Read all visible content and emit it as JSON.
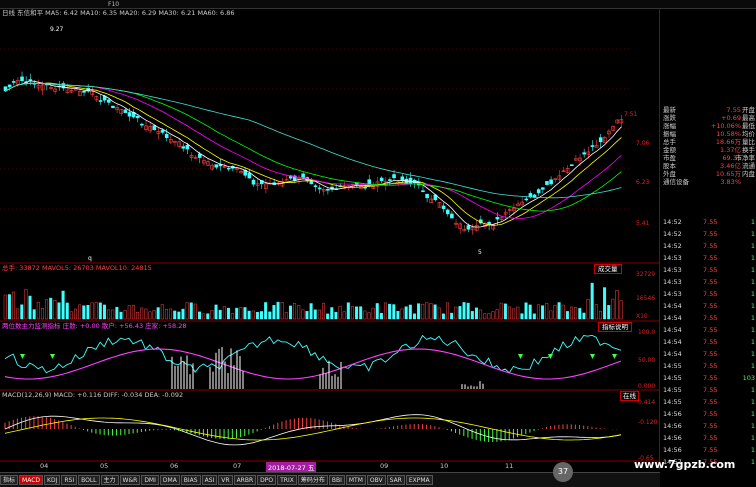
{
  "topbar": {
    "items": [
      "",
      "",
      "",
      "",
      "",
      "",
      "",
      "",
      "",
      "",
      "",
      "",
      "",
      "F10",
      "",
      "",
      "",
      "",
      "",
      "",
      "",
      "",
      "",
      ""
    ]
  },
  "main_panel": {
    "info": "日线 东信和平 MA5: 6.42 MA10: 6.35 MA20: 6.29 MA30: 6.21 MA60: 6.86",
    "high_marker": "9.27",
    "low_marker": "5",
    "marker_q": "q",
    "y_labels": [
      "7.06",
      "6.23",
      "5.41"
    ],
    "top_right_label": "7.51",
    "colors": {
      "ma5": "#ffffff",
      "ma10": "#ffff00",
      "ma20": "#ff00ff",
      "ma30": "#00ff00",
      "ma60": "#40e0d0",
      "up": "#ff4040",
      "down": "#40ffff"
    }
  },
  "volume_panel": {
    "info": "总手: 33872 MAVOL5: 26703 MAVOL10: 24815",
    "badge": "成交量",
    "y_labels": [
      "32729",
      "16546",
      "X10"
    ]
  },
  "indicator_panel": {
    "info": "两位数主力监测指标 庄散: +0.00 散户: +56.43 庄家: +58.28",
    "badge": "指标说明",
    "y_labels": [
      "100.0",
      "50.00",
      "0.000"
    ]
  },
  "macd_panel": {
    "info": "MACD(12,26,9) MACD: +0.116 DIFF: -0.034 DEA: -0.092",
    "badge": "在线",
    "y_labels": [
      "0.414",
      "-0.120",
      "-0.65"
    ]
  },
  "xaxis": {
    "labels": [
      "04",
      "05",
      "06",
      "07",
      "08",
      "09",
      "10",
      "11"
    ],
    "highlight": "2018-07-27 五"
  },
  "tabs": [
    "指标",
    "MACD",
    "KDJ",
    "RSI",
    "BOLL",
    "主力",
    "W&R",
    "DMI",
    "DMA",
    "BIAS",
    "ASI",
    "VR",
    "ARBR",
    "DPO",
    "TRIX",
    "筹码分布",
    "BBI",
    "MTM",
    "OBV",
    "SAR",
    "EXPMA"
  ],
  "active_tab": 1,
  "quote": {
    "rows": [
      {
        "label": "最新",
        "value": "7.55",
        "tag": "开盘"
      },
      {
        "label": "涨跌",
        "value": "+0.69",
        "tag": "最高"
      },
      {
        "label": "涨幅",
        "value": "+10.06%",
        "tag": "最低"
      },
      {
        "label": "振幅",
        "value": "10.58%",
        "tag": "均价"
      },
      {
        "label": "总手",
        "value": "18.66万",
        "tag": "量比"
      },
      {
        "label": "金额",
        "value": "1.37亿",
        "tag": "换手"
      },
      {
        "label": "市盈",
        "value": "69.31",
        "tag": "市净率"
      },
      {
        "label": "股本",
        "value": "3.46亿",
        "tag": "流通"
      },
      {
        "label": "外盘",
        "value": "10.65万",
        "tag": "内盘"
      },
      {
        "label": "通信设备",
        "value": "3.83%",
        "tag": ""
      }
    ]
  },
  "ticks": [
    {
      "time": "14:52",
      "price": "7.55",
      "vol": "1"
    },
    {
      "time": "14:52",
      "price": "7.55",
      "vol": "1"
    },
    {
      "time": "14:52",
      "price": "7.55",
      "vol": "1"
    },
    {
      "time": "14:53",
      "price": "7.55",
      "vol": "1"
    },
    {
      "time": "14:53",
      "price": "7.55",
      "vol": "1"
    },
    {
      "time": "14:53",
      "price": "7.55",
      "vol": "1"
    },
    {
      "time": "14:53",
      "price": "7.55",
      "vol": "1"
    },
    {
      "time": "14:54",
      "price": "7.55",
      "vol": "1"
    },
    {
      "time": "14:54",
      "price": "7.55",
      "vol": "1"
    },
    {
      "time": "14:54",
      "price": "7.55",
      "vol": "1"
    },
    {
      "time": "14:54",
      "price": "7.55",
      "vol": "1"
    },
    {
      "time": "14:54",
      "price": "7.55",
      "vol": "1"
    },
    {
      "time": "14:55",
      "price": "7.55",
      "vol": "1"
    },
    {
      "time": "14:55",
      "price": "7.55",
      "vol": "103"
    },
    {
      "time": "14:55",
      "price": "7.55",
      "vol": "1"
    },
    {
      "time": "14:55",
      "price": "7.55",
      "vol": "1"
    },
    {
      "time": "14:56",
      "price": "7.55",
      "vol": "1"
    },
    {
      "time": "14:56",
      "price": "7.55",
      "vol": "1"
    },
    {
      "time": "14:56",
      "price": "7.55",
      "vol": "1"
    },
    {
      "time": "14:56",
      "price": "7.55",
      "vol": "1"
    },
    {
      "time": "14:57",
      "price": "7.55",
      "vol": "1"
    }
  ],
  "watermark": {
    "badge": "37",
    "text": "www.7gpzb.com"
  }
}
